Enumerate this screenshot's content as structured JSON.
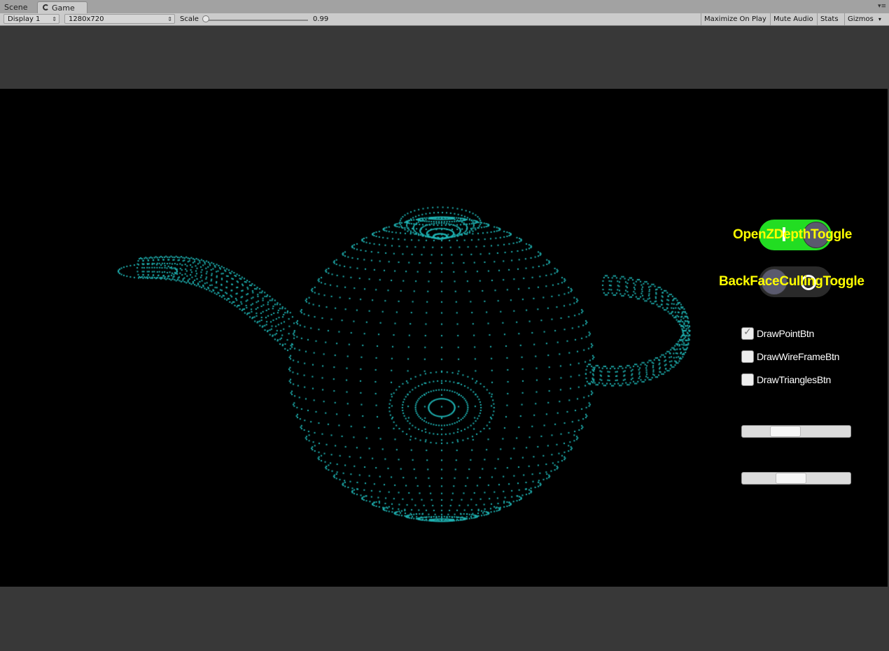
{
  "tabs": [
    {
      "label": "Scene",
      "active": false
    },
    {
      "label": "Game",
      "active": true
    }
  ],
  "toolbar": {
    "display": "Display 1",
    "resolution": "1280x720",
    "scale_label": "Scale",
    "scale_value": "0.99",
    "buttons": [
      "Maximize On Play",
      "Mute Audio",
      "Stats",
      "Gizmos"
    ]
  },
  "overlay": {
    "zdepth_toggle": {
      "label": "OpenZDepthToggle",
      "on": true,
      "color": "#22dd22"
    },
    "backface_toggle": {
      "label": "BackFaceCullingToggle",
      "on": false,
      "color": "#2a2a2a"
    },
    "checkboxes": [
      {
        "label": "DrawPointBtn",
        "checked": true
      },
      {
        "label": "DrawWireFrameBtn",
        "checked": false
      },
      {
        "label": "DrawTrianglesBtn",
        "checked": false
      }
    ],
    "sliders": [
      0.36,
      0.43
    ]
  },
  "scene": {
    "point_color": "#1fb3b3",
    "background": "#000000"
  }
}
